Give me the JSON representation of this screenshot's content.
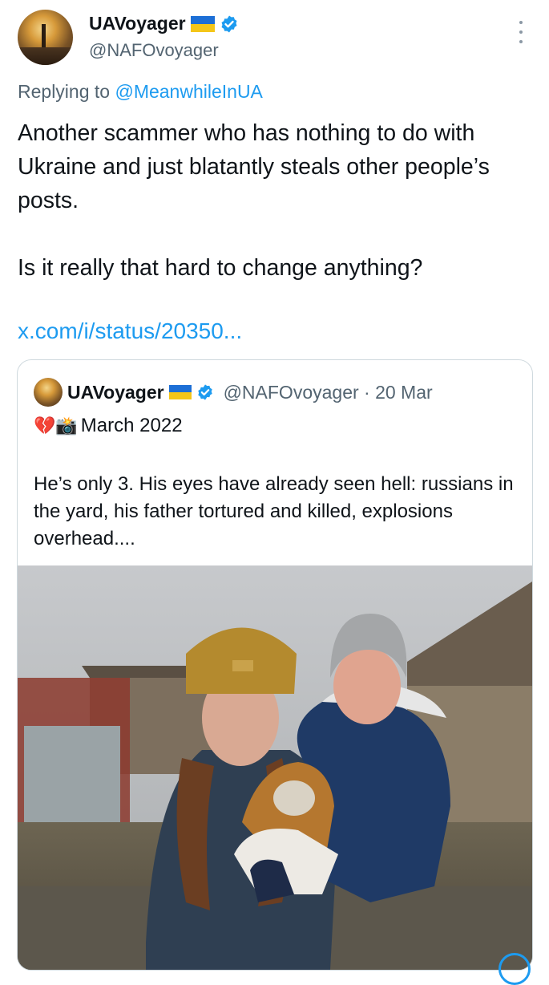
{
  "author": {
    "display_name": "UAVoyager",
    "handle": "@NAFOvoyager"
  },
  "reply": {
    "prefix": "Replying to",
    "mention": "@MeanwhileInUA"
  },
  "tweet": {
    "paragraph1": "Another scammer who has nothing to do with Ukraine and just blatantly steals other people’s posts.",
    "paragraph2": "Is it really that hard to change anything?",
    "link": "x.com/i/status/20350..."
  },
  "quoted": {
    "display_name": "UAVoyager",
    "handle_date": "@NAFOvoyager · 20 Mar",
    "emojis": "💔📸",
    "line1": "March 2022",
    "body": "He’s only 3. His eyes have already seen hell: russians in the yard, his father tortured and killed, explosions overhead...."
  },
  "colors": {
    "accent": "#1d9bf0",
    "secondary_text": "#536471",
    "flag_blue": "#1d6fd6",
    "flag_yellow": "#f4c619"
  },
  "icons": [
    "verified-badge-icon",
    "more-options-icon",
    "ukraine-flag-icon"
  ]
}
